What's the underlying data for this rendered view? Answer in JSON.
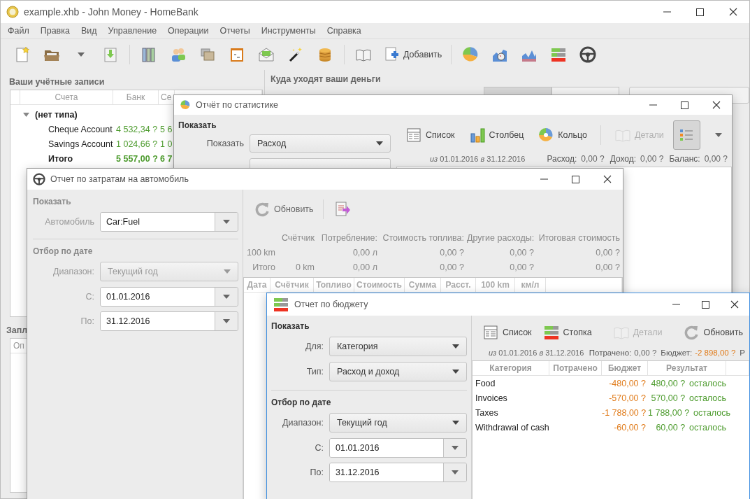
{
  "main_window": {
    "title": "example.xhb - John Money - HomeBank",
    "menu": [
      "Файл",
      "Правка",
      "Вид",
      "Управление",
      "Операции",
      "Отчеты",
      "Инструменты",
      "Справка"
    ],
    "add_button": {
      "label": "Добавить"
    },
    "accounts": {
      "title": "Ваши учётные записи",
      "columns": [
        "Счета",
        "Банк",
        "Се"
      ],
      "groups": [
        {
          "label": "(нет типа)",
          "expanded": true,
          "rows": [
            {
              "name": "Cheque Account",
              "bank": "4 532,34 ?",
              "column_3": "5 6"
            },
            {
              "name": "Savings Account",
              "bank": "1 024,66 ?",
              "column_3": "1 0"
            }
          ]
        }
      ],
      "total": {
        "name": "Итого",
        "bank": "5 557,00 ?",
        "column_3": "6 7"
      }
    },
    "spending": {
      "title": "Куда уходят ваши деньги",
      "view_switch": [
        {
          "selected": true
        },
        {
          "selected": false
        }
      ]
    },
    "scheduled": {
      "title": "Запл",
      "column": "Оп"
    }
  },
  "stats_window": {
    "title": "Отчёт по статистике",
    "section": "Показать",
    "show_label": "Показать",
    "show_value": "Расход",
    "toolbar": [
      {
        "kind": "list",
        "label": "Список",
        "disabled": false,
        "selected": false
      },
      {
        "kind": "bars",
        "label": "Столбец",
        "disabled": false,
        "selected": false
      },
      {
        "kind": "ring",
        "label": "Кольцо",
        "disabled": false,
        "selected": false
      },
      {
        "kind": "details",
        "label": "Детали",
        "disabled": true,
        "selected": false
      },
      {
        "kind": "legend",
        "selected": true
      }
    ],
    "period": "*из* 01.01.2016 *в* 31.12.2016",
    "totals": [
      {
        "label": "Расход:",
        "value": "0,00 ?",
        "kind": "plain"
      },
      {
        "label": "Доход:",
        "value": "0,00 ?",
        "kind": "plain"
      },
      {
        "label": "Баланс:",
        "value": "0,00 ?",
        "kind": "plain"
      }
    ]
  },
  "car_window": {
    "title": "Отчет по затратам на автомобиль",
    "section": "Показать",
    "vehicle_label": "Автомобиль",
    "vehicle": "Car:Fuel",
    "date_section": "Отбор по дате",
    "range_label": "Диапазон:",
    "range": {
      "value": "Текущий год",
      "disabled": true
    },
    "from_label": "С:",
    "from": "01.01.2016",
    "to_label": "По:",
    "to": "31.12.2016",
    "refresh": {
      "label": "Обновить"
    },
    "summary": {
      "columns": [
        "Счётчик",
        "Потребление:",
        "Стоимость топлива:",
        "Другие расходы:",
        "Итоговая стоимость"
      ],
      "rows": [
        {
          "label": "100 km",
          "values": [
            "0,00 л",
            "0,00 ?",
            "0,00 ?",
            "0,00 ?"
          ]
        },
        {
          "label": "Итого",
          "odometer": "0 km",
          "values": [
            "0,00 л",
            "0,00 ?",
            "0,00 ?",
            "0,00 ?"
          ]
        }
      ]
    },
    "table": {
      "columns": [
        "Дата",
        "Счётчик",
        "Топливо",
        "Стоимость",
        "Сумма",
        "Расст.",
        "100 km",
        "км/л"
      ]
    }
  },
  "budget_window": {
    "title": "Отчет по бюджету",
    "section": "Показать",
    "for_label": "Для:",
    "for_value": "Категория",
    "type_label": "Тип:",
    "type_value": "Расход и доход",
    "date_section": "Отбор по дате",
    "range_label": "Диапазон:",
    "range": {
      "value": "Текущий год",
      "disabled": false
    },
    "from_label": "С:",
    "from": "01.01.2016",
    "to_label": "По:",
    "to": "31.12.2016",
    "toolbar": [
      {
        "kind": "list",
        "label": "Список",
        "disabled": false
      },
      {
        "kind": "stack",
        "label": "Стопка",
        "disabled": false
      },
      {
        "kind": "details",
        "label": "Детали",
        "disabled": true
      },
      {
        "kind": "refresh",
        "label": "Обновить",
        "disabled": false
      }
    ],
    "period": "*из* 01.01.2016 *в* 31.12.2016",
    "totals": [
      {
        "label": "Потрачено:",
        "value": "0,00 ?",
        "kind": "plain"
      },
      {
        "label": "Бюджет:",
        "value": "-2 898,00 ?",
        "kind": "negative"
      },
      {
        "label": "Р"
      }
    ],
    "table": {
      "columns": [
        "Категория",
        "Потрачено",
        "Бюджет",
        "Результат"
      ],
      "rows": [
        {
          "category": "Food",
          "budget": "-480,00 ?",
          "result": "480,00 ?",
          "note": "осталось"
        },
        {
          "category": "Invoices",
          "budget": "-570,00 ?",
          "result": "570,00 ?",
          "note": "осталось"
        },
        {
          "category": "Taxes",
          "budget": "-1 788,00 ?",
          "result": "1 788,00 ?",
          "note": "осталось"
        },
        {
          "category": "Withdrawal of cash",
          "budget": "-60,00 ?",
          "result": "60,00 ?",
          "note": "осталось"
        }
      ]
    }
  }
}
